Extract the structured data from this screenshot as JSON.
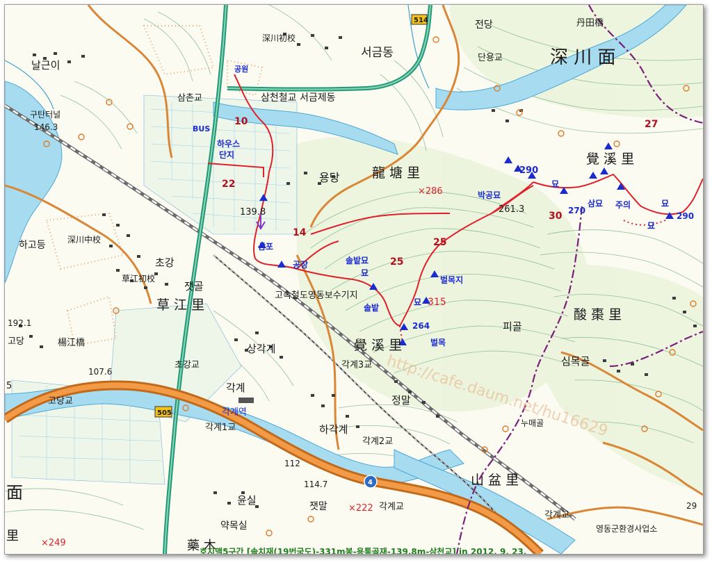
{
  "map": {
    "place_labels_black": [
      {
        "text": "날근이"
      },
      {
        "text": "深川初校"
      },
      {
        "text": "서금동"
      },
      {
        "text": "전당"
      },
      {
        "text": "단용교"
      },
      {
        "text": "丹田橋"
      },
      {
        "text": "深 川 面"
      },
      {
        "text": "삼촌교"
      },
      {
        "text": "삼천철교 서금제동"
      },
      {
        "text": "구탄터널"
      },
      {
        "text": "146.3"
      },
      {
        "text": "용당"
      },
      {
        "text": "龍 塘 里"
      },
      {
        "text": "覺 溪 里"
      },
      {
        "text": "261.3"
      },
      {
        "text": "139.8"
      },
      {
        "text": "하고등"
      },
      {
        "text": "深川中校"
      },
      {
        "text": "초강"
      },
      {
        "text": "草江初校"
      },
      {
        "text": "잿골"
      },
      {
        "text": "草 江 里"
      },
      {
        "text": "고속철도영동보수기지"
      },
      {
        "text": "192.1"
      },
      {
        "text": "고당"
      },
      {
        "text": "楊江橋"
      },
      {
        "text": "107.6"
      },
      {
        "text": "초강교"
      },
      {
        "text": "상각계"
      },
      {
        "text": "覺 溪 里"
      },
      {
        "text": "각계3교"
      },
      {
        "text": "피골"
      },
      {
        "text": "酸 棗 里"
      },
      {
        "text": "심목골"
      },
      {
        "text": "고당교"
      },
      {
        "text": "각계역"
      },
      {
        "text": "각계"
      },
      {
        "text": "정말"
      },
      {
        "text": "각계1교"
      },
      {
        "text": "하각계"
      },
      {
        "text": "각계2교"
      },
      {
        "text": "누매골"
      },
      {
        "text": "山 盆 里"
      },
      {
        "text": "112"
      },
      {
        "text": "114.7"
      },
      {
        "text": "面"
      },
      {
        "text": "윤실"
      },
      {
        "text": "잿말"
      },
      {
        "text": "각계교"
      },
      {
        "text": "각계교"
      },
      {
        "text": "영동군환경사업소"
      },
      {
        "text": "약목실"
      },
      {
        "text": "藥 木"
      },
      {
        "text": "里"
      },
      {
        "text": "5"
      },
      {
        "text": "29"
      }
    ],
    "route_labels_blue": [
      {
        "text": "공원"
      },
      {
        "text": "BUS"
      },
      {
        "text": "하우스"
      },
      {
        "text": "단지"
      },
      {
        "text": "삼포"
      },
      {
        "text": "공장"
      },
      {
        "text": "솔밭"
      },
      {
        "text": "묘"
      },
      {
        "text": "묘"
      },
      {
        "text": "솔밭"
      },
      {
        "text": "묘"
      },
      {
        "text": "벌목지"
      },
      {
        "text": "264"
      },
      {
        "text": "벌목"
      },
      {
        "text": "박공묘"
      },
      {
        "text": "290"
      },
      {
        "text": "묘"
      },
      {
        "text": "270"
      },
      {
        "text": "삼묘"
      },
      {
        "text": "주의"
      },
      {
        "text": "묘"
      },
      {
        "text": "묘"
      },
      {
        "text": "290"
      }
    ],
    "distance_labels_red": [
      {
        "text": "10"
      },
      {
        "text": "22"
      },
      {
        "text": "14"
      },
      {
        "text": "25"
      },
      {
        "text": "25"
      },
      {
        "text": "315"
      },
      {
        "text": "30"
      },
      {
        "text": "27"
      },
      {
        "text": "×286"
      },
      {
        "text": "×222"
      },
      {
        "text": "×249"
      }
    ],
    "road_shields": [
      {
        "text": "514"
      },
      {
        "text": "505"
      },
      {
        "text": "4"
      }
    ],
    "watermark": "http://cafe.daum.net/hu16629",
    "caption": "호지맥5구간 [솔치재(19번국도)-331m봉-용통골재-139.8m-삼천교] in 2012. 9. 23."
  },
  "colors": {
    "route_red": "#e0202a",
    "river_blue": "#7fc8e6",
    "road_orange": "#d77a2a",
    "road_green": "#1f9a74",
    "contour_green": "#69ad7d",
    "boundary_purple": "#7a1f7a",
    "marker_blue": "#1b2bd0",
    "shield_yellow": "#f2c21a"
  }
}
